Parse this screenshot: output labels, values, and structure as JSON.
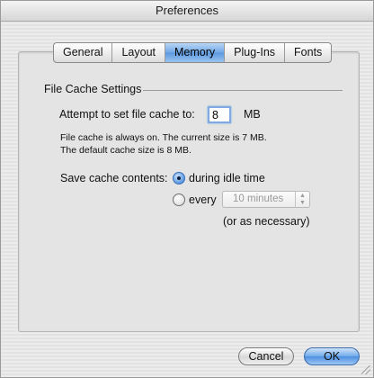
{
  "window": {
    "title": "Preferences"
  },
  "tabs": [
    {
      "label": "General",
      "active": false
    },
    {
      "label": "Layout",
      "active": false
    },
    {
      "label": "Memory",
      "active": true
    },
    {
      "label": "Plug-Ins",
      "active": false
    },
    {
      "label": "Fonts",
      "active": false
    }
  ],
  "section": {
    "title": "File Cache Settings"
  },
  "cache": {
    "label": "Attempt to set file cache to:",
    "value": "8",
    "unit": "MB",
    "info_line1": "File cache is always on.  The current size is 7 MB.",
    "info_line2": "The default cache size is 8 MB."
  },
  "save": {
    "label": "Save cache contents:",
    "option_idle": "during idle time",
    "option_every": "every",
    "interval": "10 minutes",
    "note": "(or as necessary)",
    "selected": "during idle time"
  },
  "buttons": {
    "cancel": "Cancel",
    "ok": "OK"
  },
  "colors": {
    "accent": "#5d99df"
  }
}
